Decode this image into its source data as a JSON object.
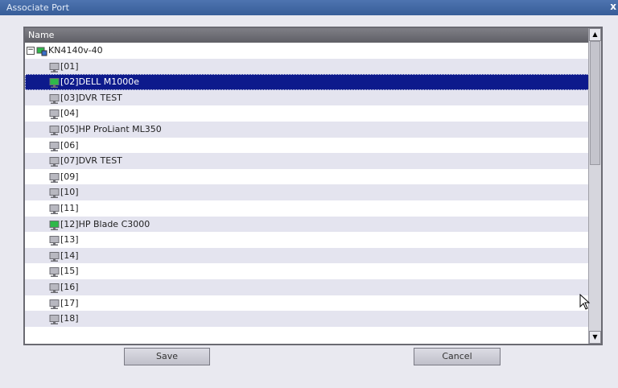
{
  "window": {
    "title": "Associate Port",
    "close_label": "x"
  },
  "tree": {
    "column_header": "Name",
    "root": {
      "label": "KN4140v-40",
      "expander": "−"
    },
    "ports": [
      {
        "label": "[01]",
        "active": false
      },
      {
        "label": "[02]DELL M1000e",
        "active": true,
        "selected": true
      },
      {
        "label": "[03]DVR TEST",
        "active": false
      },
      {
        "label": "[04]",
        "active": false
      },
      {
        "label": "[05]HP  ProLiant ML350",
        "active": false
      },
      {
        "label": "[06]",
        "active": false
      },
      {
        "label": "[07]DVR TEST",
        "active": false
      },
      {
        "label": "[09]",
        "active": false
      },
      {
        "label": "[10]",
        "active": false
      },
      {
        "label": "[11]",
        "active": false
      },
      {
        "label": "[12]HP Blade C3000",
        "active": true
      },
      {
        "label": "[13]",
        "active": false
      },
      {
        "label": "[14]",
        "active": false
      },
      {
        "label": "[15]",
        "active": false
      },
      {
        "label": "[16]",
        "active": false
      },
      {
        "label": "[17]",
        "active": false
      },
      {
        "label": "[18]",
        "active": false
      }
    ]
  },
  "buttons": {
    "save": "Save",
    "cancel": "Cancel"
  },
  "colors": {
    "selection": "#0d1a8c",
    "titlebar": "#4e74b0",
    "port_active": "#2fb84a",
    "port_idle": "#6e6e74"
  }
}
